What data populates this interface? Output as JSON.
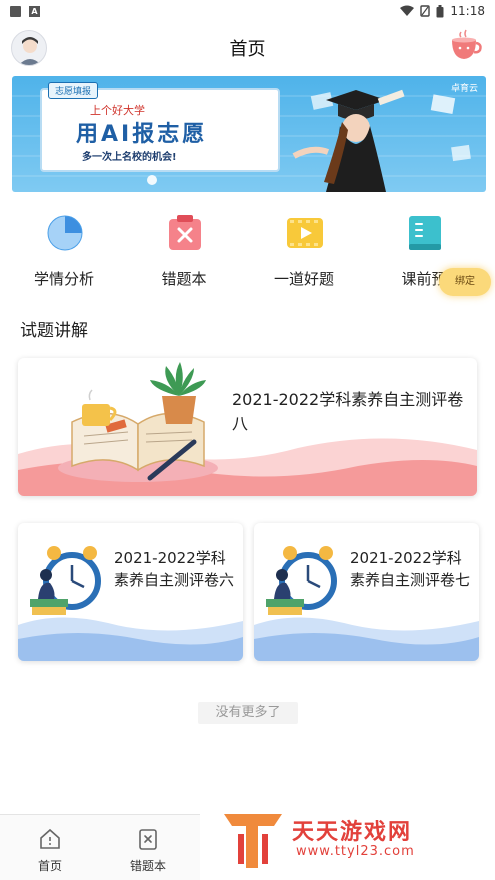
{
  "status_bar": {
    "time": "11:18"
  },
  "header": {
    "title": "首页"
  },
  "banner": {
    "tag": "志愿填报",
    "line1": "上个好大学",
    "headline": "用AI报志愿",
    "subline": "多一次上名校的机会!",
    "brand": "卓育云"
  },
  "features": [
    {
      "label": "学情分析",
      "icon": "pie-chart-icon",
      "color": "#4a9fe8"
    },
    {
      "label": "错题本",
      "icon": "wrong-book-icon",
      "color": "#ef5a5a"
    },
    {
      "label": "一道好题",
      "icon": "video-icon",
      "color": "#f5c028"
    },
    {
      "label": "课前预",
      "icon": "book-icon",
      "color": "#33b8c6"
    }
  ],
  "bind_badge": "绑定",
  "section": {
    "title": "试题讲解"
  },
  "cards": [
    {
      "title": "2021-2022学科素养自主测评卷八"
    },
    {
      "title": "2021-2022学科素养自主测评卷六"
    },
    {
      "title": "2021-2022学科素养自主测评卷七"
    }
  ],
  "no_more": "没有更多了",
  "bottom_nav": [
    {
      "label": "首页",
      "icon": "home-icon"
    },
    {
      "label": "错题本",
      "icon": "wrong-book-icon"
    }
  ],
  "watermark": {
    "text": "天天游戏网",
    "url": "www.ttyl23.com"
  }
}
